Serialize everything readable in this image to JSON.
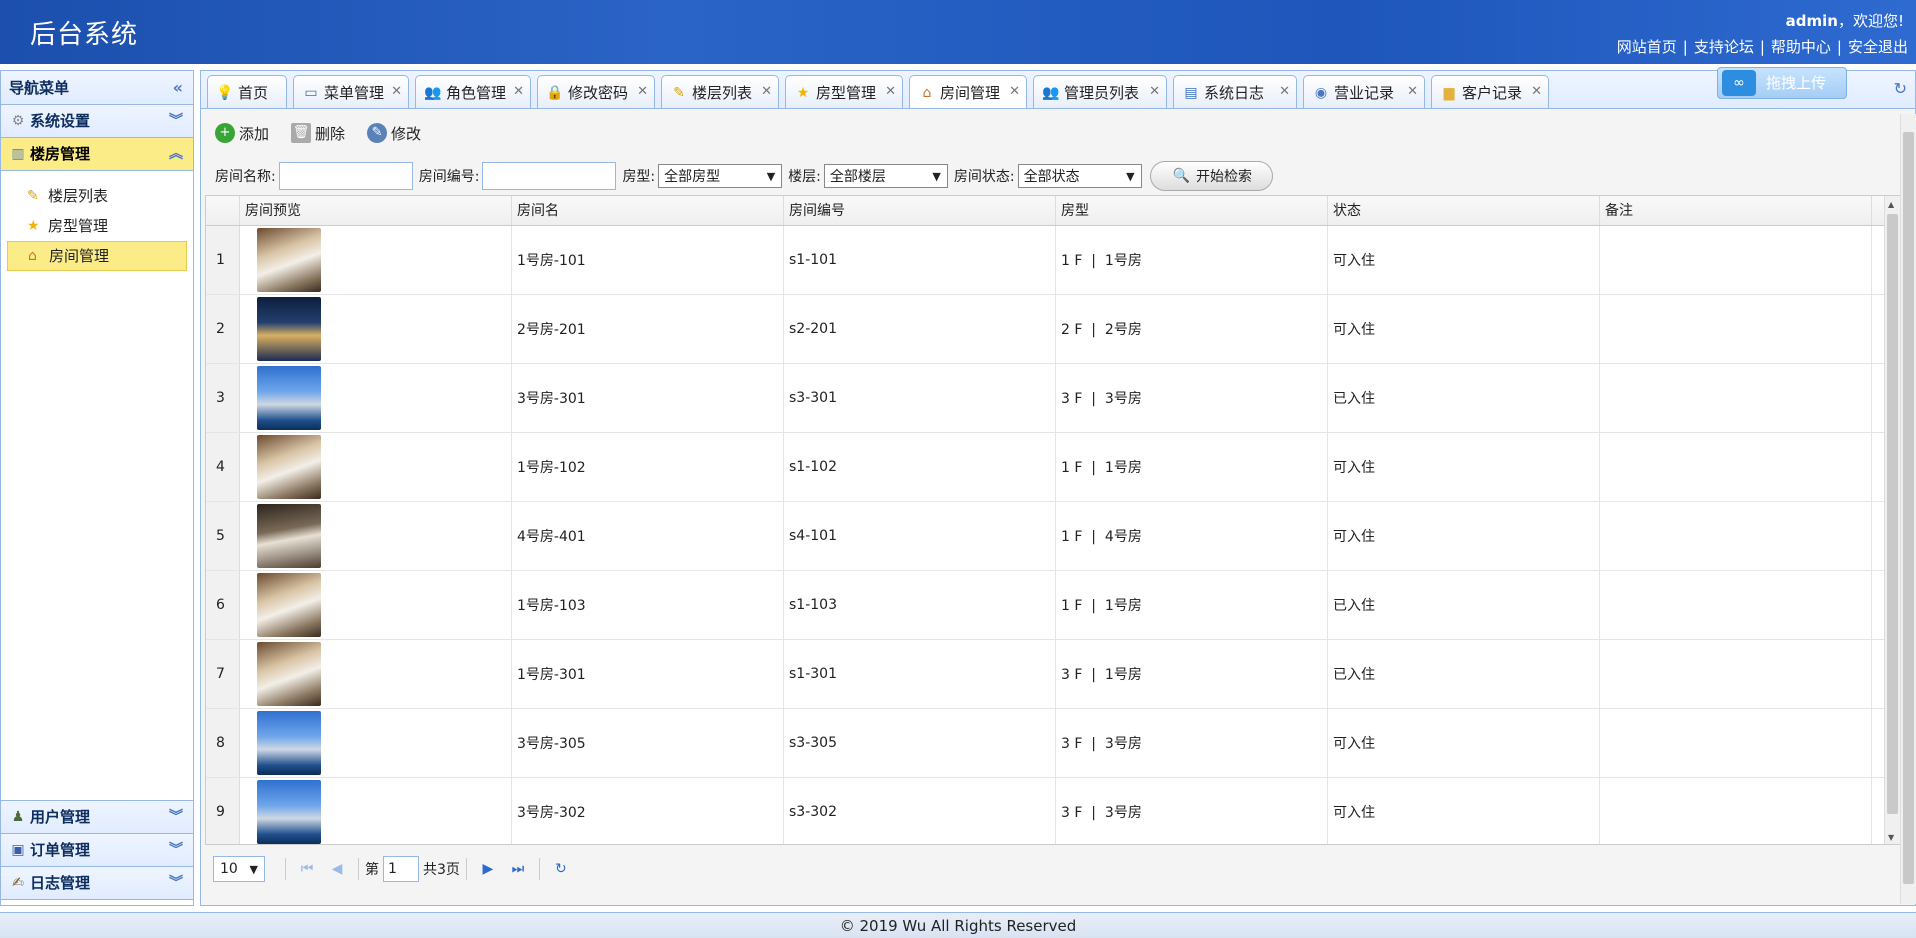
{
  "app": {
    "title": "后台系统"
  },
  "header": {
    "user": "admin",
    "welcome_suffix": "，欢迎您!",
    "links": [
      "网站首页",
      "支持论坛",
      "帮助中心",
      "安全退出"
    ],
    "separator": "|"
  },
  "sidebar": {
    "title": "导航菜单",
    "groups": [
      {
        "label": "系统设置",
        "icon": "gear-icon"
      },
      {
        "label": "楼房管理",
        "icon": "building-icon"
      },
      {
        "label": "用户管理",
        "icon": "user-icon"
      },
      {
        "label": "订单管理",
        "icon": "save-icon"
      },
      {
        "label": "日志管理",
        "icon": "edit-icon"
      }
    ],
    "items": [
      {
        "label": "楼层列表",
        "icon": "broom-icon"
      },
      {
        "label": "房型管理",
        "icon": "star-icon"
      },
      {
        "label": "房间管理",
        "icon": "house-icon"
      }
    ]
  },
  "tabs": [
    {
      "label": "首页",
      "icon": "bulb-icon",
      "closable": false
    },
    {
      "label": "菜单管理",
      "icon": "window-icon"
    },
    {
      "label": "角色管理",
      "icon": "users-icon"
    },
    {
      "label": "修改密码",
      "icon": "lock-icon"
    },
    {
      "label": "楼层列表",
      "icon": "broom-icon"
    },
    {
      "label": "房型管理",
      "icon": "star-icon"
    },
    {
      "label": "房间管理",
      "icon": "house-icon",
      "active": true
    },
    {
      "label": "管理员列表",
      "icon": "users-icon"
    },
    {
      "label": "系统日志",
      "icon": "doc-icon"
    },
    {
      "label": "营业记录",
      "icon": "eye-icon"
    },
    {
      "label": "客户记录",
      "icon": "folder-icon"
    }
  ],
  "upload": {
    "label": "拖拽上传"
  },
  "toolbar": {
    "add": "添加",
    "delete": "删除",
    "edit": "修改"
  },
  "filter": {
    "room_name_label": "房间名称:",
    "room_number_label": "房间编号:",
    "type_label": "房型:",
    "type_value": "全部房型",
    "floor_label": "楼层:",
    "floor_value": "全部楼层",
    "status_label": "房间状态:",
    "status_value": "全部状态",
    "search": "开始检索"
  },
  "grid": {
    "columns": [
      "房间预览",
      "房间名",
      "房间编号",
      "房型",
      "状态",
      "备注"
    ],
    "rows": [
      {
        "n": "1",
        "img": "room",
        "name": "1号房-101",
        "code": "s1-101",
        "type": "1 F  |  1号房",
        "status": "可入住",
        "note": ""
      },
      {
        "n": "2",
        "img": "night",
        "name": "2号房-201",
        "code": "s2-201",
        "type": "2 F  |  2号房",
        "status": "可入住",
        "note": ""
      },
      {
        "n": "3",
        "img": "villa",
        "name": "3号房-301",
        "code": "s3-301",
        "type": "3 F  |  3号房",
        "status": "已入住",
        "note": ""
      },
      {
        "n": "4",
        "img": "room",
        "name": "1号房-102",
        "code": "s1-102",
        "type": "1 F  |  1号房",
        "status": "可入住",
        "note": ""
      },
      {
        "n": "5",
        "img": "dark",
        "name": "4号房-401",
        "code": "s4-101",
        "type": "1 F  |  4号房",
        "status": "可入住",
        "note": ""
      },
      {
        "n": "6",
        "img": "room",
        "name": "1号房-103",
        "code": "s1-103",
        "type": "1 F  |  1号房",
        "status": "已入住",
        "note": ""
      },
      {
        "n": "7",
        "img": "room",
        "name": "1号房-301",
        "code": "s1-301",
        "type": "3 F  |  1号房",
        "status": "已入住",
        "note": ""
      },
      {
        "n": "8",
        "img": "villa",
        "name": "3号房-305",
        "code": "s3-305",
        "type": "3 F  |  3号房",
        "status": "可入住",
        "note": ""
      },
      {
        "n": "9",
        "img": "villa",
        "name": "3号房-302",
        "code": "s3-302",
        "type": "3 F  |  3号房",
        "status": "可入住",
        "note": ""
      },
      {
        "n": "",
        "img": "dark",
        "name": "",
        "code": "",
        "type": "",
        "status": "",
        "note": ""
      }
    ]
  },
  "pager": {
    "page_size": "10",
    "page_prefix": "第",
    "page": "1",
    "total": "共3页"
  },
  "footer": {
    "text": "© 2019 Wu All Rights Reserved"
  }
}
